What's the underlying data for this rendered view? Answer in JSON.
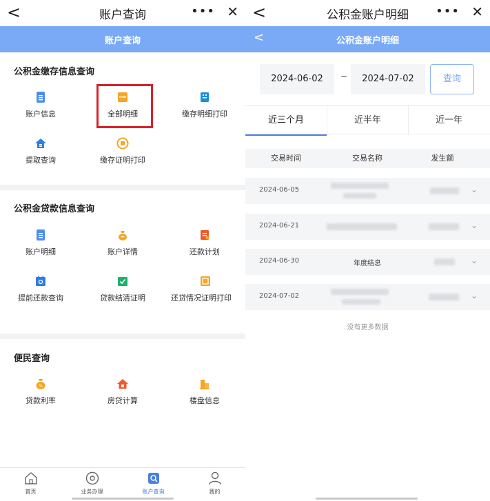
{
  "left": {
    "titlebar": {
      "back": "<",
      "title": "账户查询",
      "more": "•••",
      "close": "✕"
    },
    "bluebar": {
      "title": "账户查询"
    },
    "deposit": {
      "title": "公积金缴存信息查询",
      "items": [
        {
          "label": "账户信息",
          "icon": "document-icon"
        },
        {
          "label": "全部明细",
          "icon": "list-icon"
        },
        {
          "label": "缴存明细打印",
          "icon": "print-detail-icon"
        },
        {
          "label": "提取查询",
          "icon": "home-withdraw-icon"
        },
        {
          "label": "缴存证明打印",
          "icon": "certificate-print-icon"
        }
      ]
    },
    "loan": {
      "title": "公积金贷款信息查询",
      "items": [
        {
          "label": "账户明细",
          "icon": "document-icon"
        },
        {
          "label": "账户详情",
          "icon": "money-bag-icon"
        },
        {
          "label": "还款计划",
          "icon": "plan-icon"
        },
        {
          "label": "提前还款查询",
          "icon": "calendar-search-icon"
        },
        {
          "label": "贷款结清证明",
          "icon": "shield-check-icon"
        },
        {
          "label": "还贷情况证明打印",
          "icon": "certificate-icon"
        }
      ]
    },
    "service": {
      "title": "便民查询",
      "items": [
        {
          "label": "贷款利率",
          "icon": "rate-bag-icon"
        },
        {
          "label": "房贷计算",
          "icon": "house-calc-icon"
        },
        {
          "label": "楼盘信息",
          "icon": "building-icon"
        }
      ]
    },
    "nav": [
      {
        "label": "首页",
        "icon": "home-icon"
      },
      {
        "label": "业务办理",
        "icon": "business-icon"
      },
      {
        "label": "账户查询",
        "icon": "account-query-icon"
      },
      {
        "label": "我的",
        "icon": "user-icon"
      }
    ]
  },
  "right": {
    "titlebar": {
      "back": "<",
      "title": "公积金账户明细",
      "more": "•••",
      "close": "✕"
    },
    "bluebar": {
      "back": "<",
      "title": "公积金账户明细"
    },
    "filter": {
      "start_date": "2024-06-02",
      "separator": "~",
      "end_date": "2024-07-02",
      "query_label": "查询"
    },
    "tabs": [
      "近三个月",
      "近半年",
      "近一年"
    ],
    "table": {
      "headers": [
        "交易时间",
        "交易名称",
        "发生额"
      ],
      "rows": [
        {
          "date": "2024-06-05",
          "name": ""
        },
        {
          "date": "2024-06-21",
          "name": ""
        },
        {
          "date": "2024-06-30",
          "name": "年度结息"
        },
        {
          "date": "2024-07-02",
          "name": ""
        }
      ]
    },
    "no_more": "没有更多数据"
  },
  "colors": {
    "accent": "#7aaaf6",
    "highlight": "#d9222a",
    "active_nav": "#4a7de0"
  }
}
